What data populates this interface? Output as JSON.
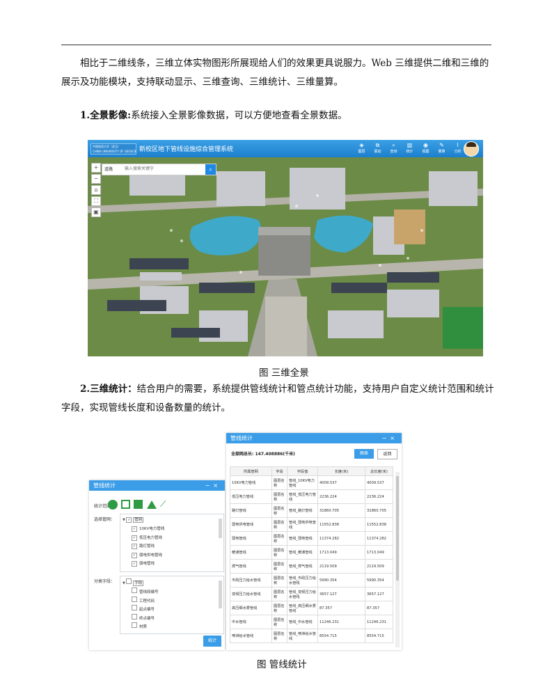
{
  "paragraphs": {
    "p1": "相比于二维线条，三维立体实物图形所展现给人们的效果更具说服力。Web 三维提供二维和三维的展示及功能模块，支持联动显示、三维查询、三维统计、三维量算。",
    "p2_bold": "1.全景影像:",
    "p2_rest": "系统接入全景影像数据，可以方便地查看全景数据。",
    "p3_bold": "2.三维统计：",
    "p3_rest": "结合用户的需要，系统提供管线统计和管点统计功能，支持用户自定义统计范围和统计字段，实现管线长度和设备数量的统计。"
  },
  "captions": {
    "fig1": "图  三维全景",
    "fig2": "图  管线统计"
  },
  "scene": {
    "logo_line1": "中国地质大学（武汉）",
    "logo_line2": "CHINA UNIVERSITY OF GEOSCIENCES",
    "title": "新校区地下管线设施综合管理系统",
    "tools": [
      {
        "icon": "layers-icon",
        "glyph": "◈",
        "label": "图层"
      },
      {
        "icon": "link-icon",
        "glyph": "⧉",
        "label": "联动"
      },
      {
        "icon": "query-icon",
        "glyph": "⌕",
        "label": "查询"
      },
      {
        "icon": "stats-icon",
        "glyph": "▥",
        "label": "统计"
      },
      {
        "icon": "eye-icon",
        "glyph": "◉",
        "label": "视图"
      },
      {
        "icon": "measure-icon",
        "glyph": "✎",
        "label": "量算"
      },
      {
        "icon": "analysis-icon",
        "glyph": "⌇",
        "label": "分析"
      }
    ],
    "search_select": "道路",
    "search_placeholder": "输入搜索关键字"
  },
  "stat_panel": {
    "title": "管线统计",
    "range_label": "统计范围：",
    "layer_label": "选择管网：",
    "root_label": "管网",
    "layers": [
      "10KV电力管线",
      "低压电力管线",
      "路灯管线",
      "弱电供电管线",
      "弱电管线"
    ],
    "field_label": "分类字段：",
    "field_root": "字段",
    "fields": [
      "管线段编号",
      "工程代码",
      "起点编号",
      "终点编号",
      "材质"
    ],
    "button": "统计"
  },
  "result_panel": {
    "title": "管线统计",
    "total": "全部网总长: 147.408886(千米)",
    "chart_button": "图表",
    "back_button": "返回",
    "columns": [
      "所属管网",
      "字段",
      "字段值",
      "长度(米)",
      "总长度(米)"
    ],
    "rows": [
      [
        "10KV电力管线",
        "图层名称",
        "管线_10KV电力管线",
        "4009.537",
        "4009.537"
      ],
      [
        "低压电力管线",
        "图层名称",
        "管线_低压电力管线",
        "2236.224",
        "2236.224"
      ],
      [
        "路灯管线",
        "图层名称",
        "管线_路灯管线",
        "31860.705",
        "31860.705"
      ],
      [
        "弱电供电管线",
        "图层名称",
        "管线_弱电供电管线",
        "11552.838",
        "11552.838"
      ],
      [
        "弱电管线",
        "图层名称",
        "管线_弱电管线",
        "11374.282",
        "11374.282"
      ],
      [
        "暖通管线",
        "图层名称",
        "管线_暖通管线",
        "1713.049",
        "1713.049"
      ],
      [
        "燃气管线",
        "图层名称",
        "管线_燃气管线",
        "2119.509",
        "2119.509"
      ],
      [
        "市政压力给水管线",
        "图层名称",
        "管线_市政压力给水管线",
        "5990.354",
        "5990.354"
      ],
      [
        "变频压力给水管线",
        "图层名称",
        "管线_变频压力给水管线",
        "3657.127",
        "3657.127"
      ],
      [
        "高压细水雾管线",
        "图层名称",
        "管线_高压细水雾管线",
        "87.357",
        "87.357"
      ],
      [
        "中水管线",
        "图层名称",
        "管线_中水管线",
        "11246.231",
        "11246.231"
      ],
      [
        "喷淋给水管线",
        "图层名称",
        "管线_喷淋给水管线",
        "8554.715",
        "8554.715"
      ]
    ]
  },
  "colors": {
    "accent": "#3b9de8",
    "grass": "#6f8f4a",
    "water": "#3fa9c9"
  }
}
